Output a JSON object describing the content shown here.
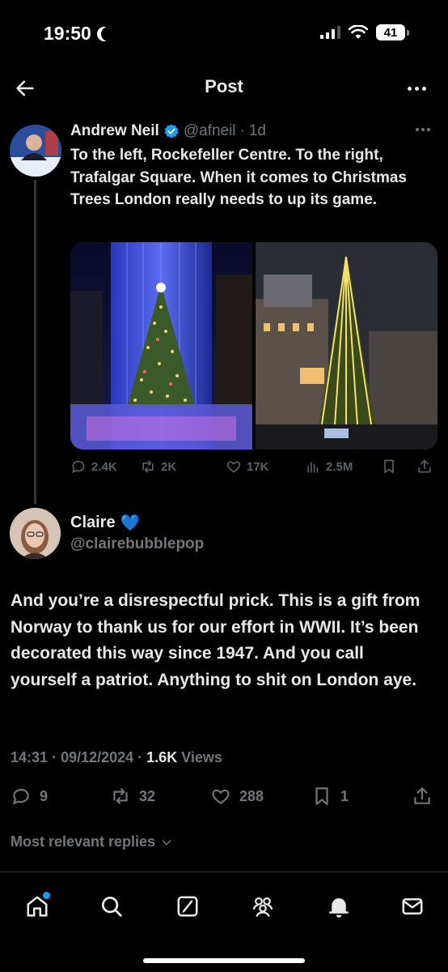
{
  "status_bar": {
    "time": "19:50",
    "battery": "41"
  },
  "header": {
    "title": "Post"
  },
  "parent_tweet": {
    "name": "Andrew Neil",
    "handle": "@afneil",
    "age": "1d",
    "separator": "·",
    "text": "To the left, Rockefeller Centre. To the right, Trafalgar Square. When it comes to Christmas Trees London really needs to up its game.",
    "avatar_label": "THE ANDREW NEIL",
    "replies": "2.4K",
    "reposts": "2K",
    "likes": "17K",
    "views": "2.5M"
  },
  "reply": {
    "name": "Claire",
    "name_emoji": "💙",
    "handle": "@clairebubblepop",
    "text": "And you’re a disrespectful prick. This is a gift from Norway to thank us for our effort in WWII. It’s been decorated this way since 1947. And you call yourself a patriot. Anything to shit on London aye.",
    "time": "14:31",
    "date": "09/12/2024",
    "views_count": "1.6K",
    "views_label": "Views",
    "replies": "9",
    "reposts": "32",
    "likes": "288",
    "bookmarks": "1"
  },
  "sort_label": "Most relevant replies",
  "nav": [
    "home",
    "search",
    "grok",
    "communities",
    "notifications",
    "messages"
  ],
  "colors": {
    "accent": "#1d9bf0",
    "text": "#e7e9ea",
    "muted": "#71767b",
    "background": "#000000"
  }
}
